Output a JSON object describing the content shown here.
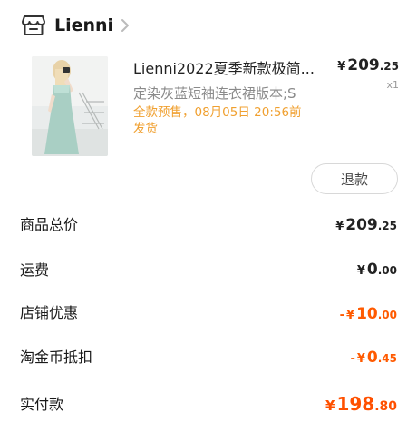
{
  "shop": {
    "name": "Lienni"
  },
  "product": {
    "title": "Lienni2022夏季新款极简...",
    "spec": "定染灰蓝短袖连衣裙版本;S",
    "presale_line1": "全款预售，08月05日 20:56前",
    "presale_line2": "发货",
    "price_yen": "¥",
    "price_int": "209",
    "price_dec": ".25",
    "quantity": "x1"
  },
  "refund_button": "退款",
  "summary": [
    {
      "label": "商品总价",
      "sign": "",
      "yen": "¥",
      "int": "209",
      "dec": ".25",
      "type": "normal"
    },
    {
      "label": "运费",
      "sign": "",
      "yen": "¥",
      "int": "0",
      "dec": ".00",
      "type": "normal"
    },
    {
      "label": "店铺优惠",
      "sign": "-",
      "yen": "¥",
      "int": "10",
      "dec": ".00",
      "type": "discount"
    },
    {
      "label": "淘金币抵扣",
      "sign": "-",
      "yen": "¥",
      "int": "0",
      "dec": ".45",
      "type": "discount"
    },
    {
      "label": "实付款",
      "sign": "",
      "yen": "¥",
      "int": "198",
      "dec": ".80",
      "type": "final"
    }
  ],
  "colors": {
    "accent": "#ff5000",
    "presale": "#f0a030",
    "muted": "#8a8a8a"
  }
}
